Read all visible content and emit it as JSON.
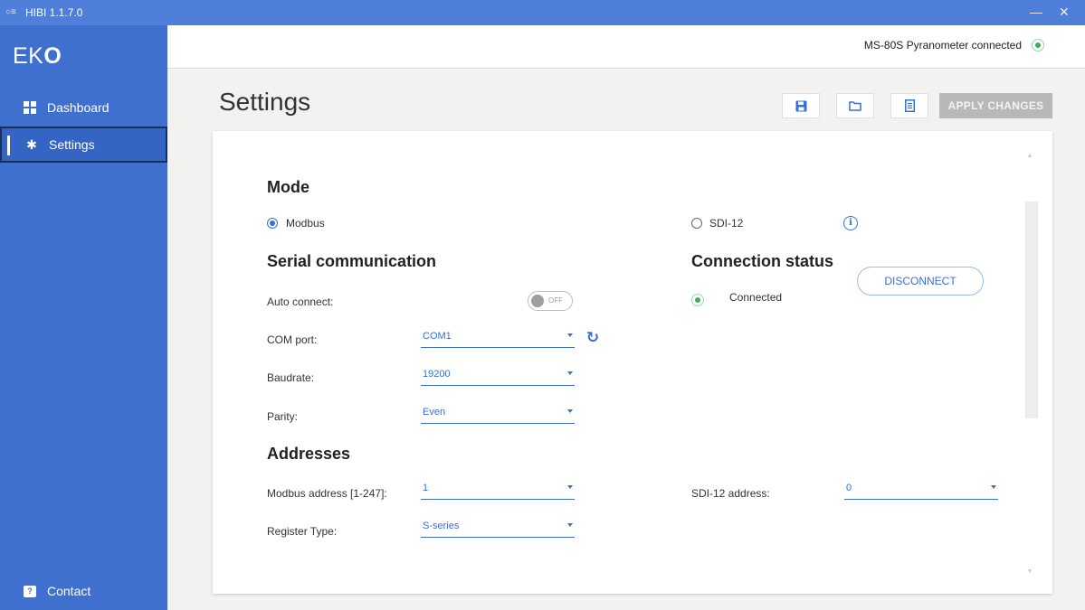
{
  "window": {
    "title": "HIBI 1.1.7.0",
    "minimize": "—",
    "close": "✕"
  },
  "sidebar": {
    "logo_prefix": "EK",
    "logo_suffix": "O",
    "items": [
      {
        "label": "Dashboard",
        "icon": "dashboard-icon"
      },
      {
        "label": "Settings",
        "icon": "gear-icon",
        "active": true
      },
      {
        "label": "Contact",
        "icon": "contact-icon"
      }
    ]
  },
  "topbar": {
    "device_status": "MS-80S Pyranometer connected"
  },
  "page": {
    "title": "Settings",
    "toolbar": {
      "save_icon": "save-icon",
      "open_icon": "folder-icon",
      "report_icon": "document-icon",
      "apply_label": "APPLY CHANGES"
    }
  },
  "mode": {
    "title": "Mode",
    "options": [
      {
        "label": "Modbus",
        "selected": true
      },
      {
        "label": "SDI-12",
        "selected": false
      }
    ],
    "info_glyph": "i"
  },
  "serial": {
    "title": "Serial communication",
    "auto_connect_label": "Auto connect:",
    "auto_connect_state": "OFF",
    "com_port_label": "COM port:",
    "com_port_value": "COM1",
    "baudrate_label": "Baudrate:",
    "baudrate_value": "19200",
    "parity_label": "Parity:",
    "parity_value": "Even"
  },
  "connection": {
    "title": "Connection status",
    "status": "Connected",
    "disconnect_label": "DISCONNECT"
  },
  "addresses": {
    "title": "Addresses",
    "modbus_label": "Modbus address [1-247]:",
    "modbus_value": "1",
    "register_label": "Register Type:",
    "register_value": "S-series",
    "sdi_label": "SDI-12 address:",
    "sdi_value": "0"
  },
  "colors": {
    "sidebar": "#3f70cf",
    "titlebar": "#4f7fd8",
    "accent": "#3a6fd1",
    "connected": "#3fae5a",
    "apply_disabled": "#b8b8b8"
  }
}
